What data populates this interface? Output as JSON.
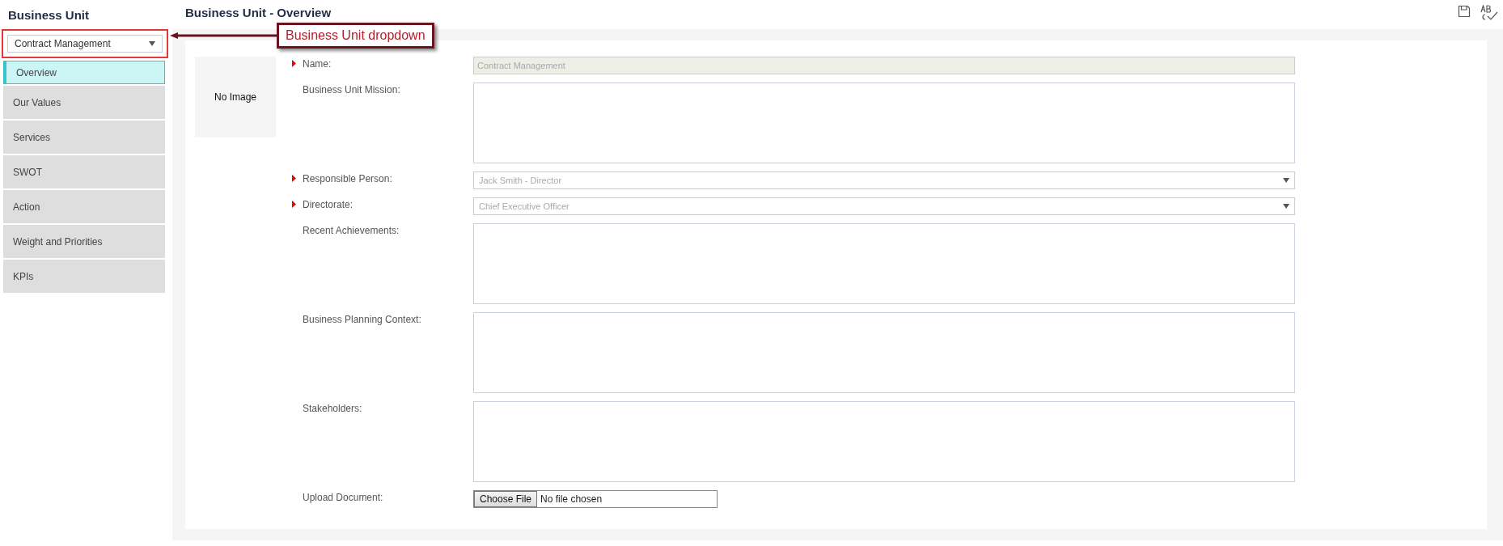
{
  "sidebar": {
    "title": "Business Unit",
    "dropdown": {
      "value": "Contract Management",
      "highlighted": true
    },
    "items": [
      {
        "label": "Overview",
        "selected": true
      },
      {
        "label": "Our Values",
        "selected": false
      },
      {
        "label": "Services",
        "selected": false
      },
      {
        "label": "SWOT",
        "selected": false
      },
      {
        "label": "Action",
        "selected": false
      },
      {
        "label": "Weight and Priorities",
        "selected": false
      },
      {
        "label": "KPIs",
        "selected": false
      }
    ]
  },
  "callout": {
    "label": "Business Unit dropdown"
  },
  "main": {
    "title": "Business Unit - Overview",
    "image_placeholder": "No Image",
    "fields": [
      {
        "kind": "text",
        "label": "Name:",
        "required": true,
        "disabled": true,
        "value": "Contract Management"
      },
      {
        "kind": "textarea",
        "label": "Business Unit Mission:",
        "required": false,
        "disabled": false
      },
      {
        "kind": "select",
        "label": "Responsible Person:",
        "required": true,
        "disabled": true,
        "value": "Jack Smith - Director"
      },
      {
        "kind": "select",
        "label": "Directorate:",
        "required": true,
        "disabled": true,
        "value": "Chief Executive Officer"
      },
      {
        "kind": "textarea",
        "label": "Recent Achievements:",
        "required": false,
        "disabled": false
      },
      {
        "kind": "textarea",
        "label": "Business Planning Context:",
        "required": false,
        "disabled": false
      },
      {
        "kind": "textarea",
        "label": "Stakeholders:",
        "required": false,
        "disabled": false
      },
      {
        "kind": "file",
        "label": "Upload Document:",
        "required": false,
        "disabled": false,
        "button": "Choose File",
        "status": "No file chosen"
      }
    ]
  }
}
